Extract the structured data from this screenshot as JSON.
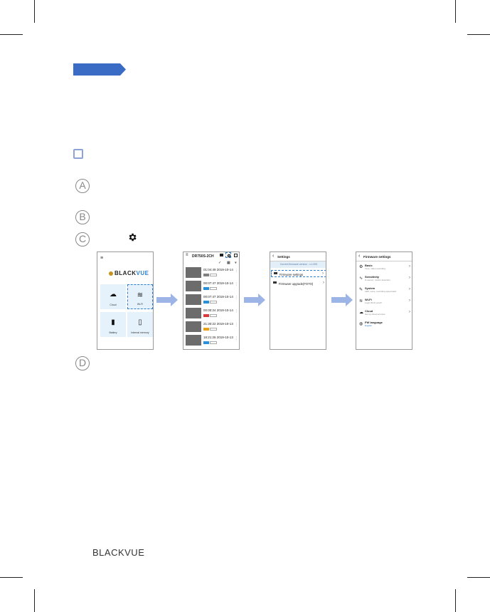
{
  "footer": {
    "brand": "BLACKVUE"
  },
  "markers": [
    "A",
    "B",
    "C",
    "D"
  ],
  "colors": {
    "accent": "#3a6cc5",
    "sky": "#e5f2fb",
    "arrow": "#9db4e6"
  },
  "screen1": {
    "logo_black": "BLACK",
    "logo_blue": "VUE",
    "tiles": [
      "Cloud",
      "Wi-Fi",
      "Battery",
      "Internal memory"
    ]
  },
  "screen2": {
    "title": "DR750S-2CH",
    "rows": [
      {
        "time": "01:04:49",
        "date": "2019-10-14",
        "tag_color": "#808080"
      },
      {
        "time": "00:07:47",
        "date": "2019-10-14",
        "tag_color": "#2a8fd8"
      },
      {
        "time": "00:07:47",
        "date": "2019-10-14",
        "tag_color": "#2a8fd8"
      },
      {
        "time": "00:00:24",
        "date": "2019-10-14",
        "tag_color": "#d63a3a"
      },
      {
        "time": "21:30:22",
        "date": "2019-10-13",
        "tag_color": "#e6a319"
      },
      {
        "time": "18:21:26",
        "date": "2019-10-13",
        "tag_color": "#2a8fd8"
      }
    ]
  },
  "screen3": {
    "title": "Settings",
    "band": "Current firmware version : v.1.000",
    "items": [
      "Firmware settings",
      "Firmware upgrade(FOTO)"
    ]
  },
  "screen4": {
    "title": "Firmware settings",
    "items": [
      {
        "label": "Basic",
        "sub": "Time, video recording"
      },
      {
        "label": "Sensitivity",
        "sub": "G-sensor, motion detection"
      },
      {
        "label": "System",
        "sub": "LED, voice, recording speed alert"
      },
      {
        "label": "Wi-Fi",
        "sub": "Login Wi-Fi on/off"
      },
      {
        "label": "Cloud",
        "sub": "Set up cloud services"
      },
      {
        "label": "FW language",
        "sub": "English"
      }
    ]
  }
}
